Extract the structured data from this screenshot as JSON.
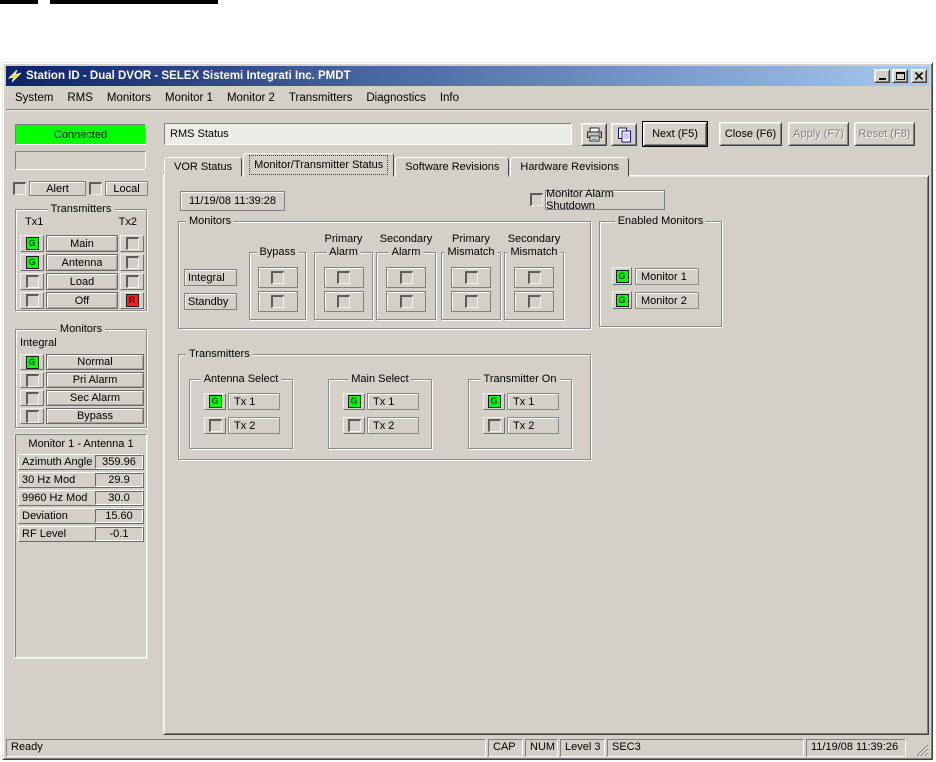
{
  "window": {
    "title": "Station ID - Dual DVOR - SELEX Sistemi Integrati Inc. PMDT"
  },
  "menu": {
    "items": [
      "System",
      "RMS",
      "Monitors",
      "Monitor 1",
      "Monitor 2",
      "Transmitters",
      "Diagnostics",
      "Info"
    ]
  },
  "toolbar": {
    "status_text": "RMS Status",
    "next_label": "Next (F5)",
    "close_label": "Close (F6)",
    "apply_label": "Apply (F7)",
    "reset_label": "Reset (F8)"
  },
  "connection": {
    "status": "Connected",
    "color": "#00ff00"
  },
  "sidebar": {
    "alert_label": "Alert",
    "local_label": "Local",
    "transmitters": {
      "title": "Transmitters",
      "col1": "Tx1",
      "col2": "Tx2",
      "rows": [
        {
          "label": "Main",
          "tx1": "G",
          "tx2": ""
        },
        {
          "label": "Antenna",
          "tx1": "G",
          "tx2": ""
        },
        {
          "label": "Load",
          "tx1": "",
          "tx2": ""
        },
        {
          "label": "Off",
          "tx1": "",
          "tx2": "R"
        }
      ]
    },
    "monitors": {
      "title": "Monitors",
      "mode": "Integral",
      "rows": [
        {
          "label": "Normal",
          "state": "G"
        },
        {
          "label": "Pri Alarm",
          "state": ""
        },
        {
          "label": "Sec Alarm",
          "state": ""
        },
        {
          "label": "Bypass",
          "state": ""
        }
      ]
    },
    "measurements": {
      "header": "Monitor 1 - Antenna 1",
      "rows": [
        {
          "label": "Azimuth Angle",
          "value": "359.96"
        },
        {
          "label": "30 Hz Mod",
          "value": "29.9"
        },
        {
          "label": "9960 Hz Mod",
          "value": "30.0"
        },
        {
          "label": "Deviation",
          "value": "15.60"
        },
        {
          "label": "RF Level",
          "value": "-0.1"
        }
      ]
    }
  },
  "tabs": {
    "items": [
      "VOR Status",
      "Monitor/Transmitter Status",
      "Software Revisions",
      "Hardware Revisions"
    ],
    "active_index": 1
  },
  "content": {
    "datetime": "11/19/08 11:39:28",
    "alarm_shutdown_label": "Monitor Alarm Shutdown",
    "monitors_group": {
      "title": "Monitors",
      "row_labels": [
        "Integral",
        "Standby"
      ],
      "columns": [
        {
          "line1": "",
          "line2": "Bypass"
        },
        {
          "line1": "Primary",
          "line2": "Alarm"
        },
        {
          "line1": "Secondary",
          "line2": "Alarm"
        },
        {
          "line1": "Primary",
          "line2": "Mismatch"
        },
        {
          "line1": "Secondary",
          "line2": "Mismatch"
        }
      ]
    },
    "enabled_monitors": {
      "title": "Enabled Monitors",
      "rows": [
        {
          "label": "Monitor 1",
          "state": "G"
        },
        {
          "label": "Monitor 2",
          "state": "G"
        }
      ]
    },
    "transmitters_group": {
      "title": "Transmitters",
      "subgroups": [
        {
          "title": "Antenna Select"
        },
        {
          "title": "Main Select"
        },
        {
          "title": "Transmitter On"
        }
      ],
      "row1": {
        "label": "Tx 1",
        "state": "G"
      },
      "row2": {
        "label": "Tx 2",
        "state": ""
      }
    }
  },
  "statusbar": {
    "ready": "Ready",
    "cap": "CAP",
    "num": "NUM",
    "level": "Level 3",
    "sec": "SEC3",
    "datetime": "11/19/08 11:39:26"
  },
  "indicator": {
    "g": "G",
    "r": "R",
    "green": "#00FF00",
    "red": "#FF1E1E"
  }
}
